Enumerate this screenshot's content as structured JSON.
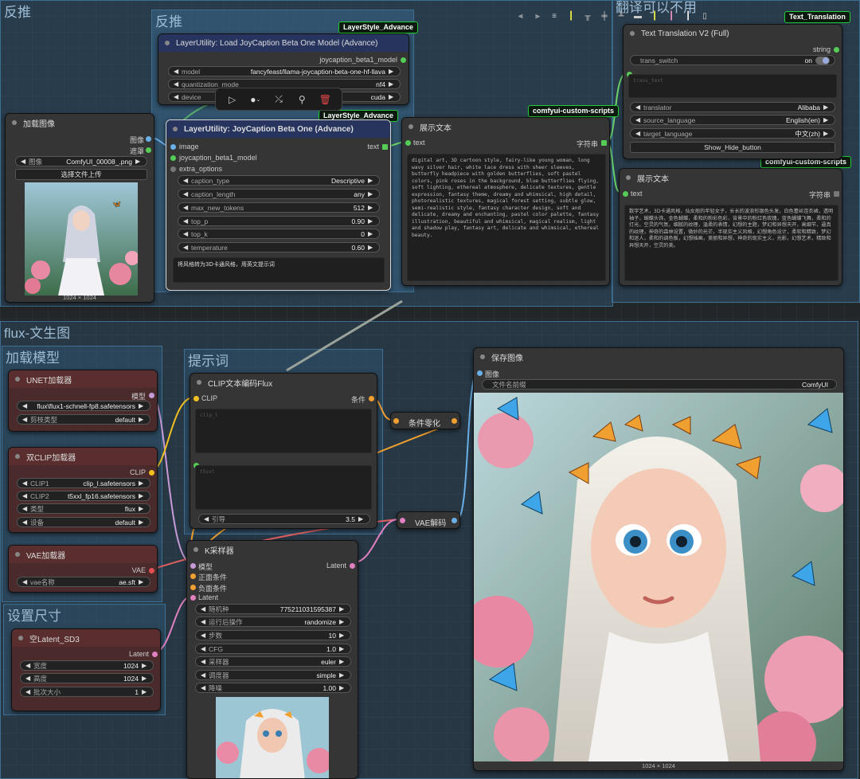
{
  "groups": {
    "top_left": "反推",
    "top_inner": "反推",
    "top_right": "翻译可以不用",
    "bottom": "flux-文生图",
    "load_model": "加载模型",
    "prompt": "提示词",
    "size": "设置尺寸"
  },
  "badges": {
    "layerstyle_1": "LayerStyle_Advance",
    "layerstyle_2": "LayerStyle_Advance",
    "custom_scripts_1": "comfyui-custom-scripts",
    "custom_scripts_2": "comfyui-custom-scripts",
    "text_translation": "Text_Translation"
  },
  "load_image": {
    "title": "加载图像",
    "out_image": "图像",
    "out_mask": "遮罩",
    "image_label": "图像",
    "image_value": "ComfyUI_00008_.png",
    "upload": "选择文件上传",
    "size": "1024 × 1024"
  },
  "load_joycaption": {
    "title": "LayerUtility: Load JoyCaption Beta One Model (Advance)",
    "out": "joycaption_beta1_model",
    "widgets": [
      {
        "label": "model",
        "value": "fancyfeast/llama-joycaption-beta-one-hf-llava"
      },
      {
        "label": "quantization_mode",
        "value": "nf4"
      },
      {
        "label": "device",
        "value": "cuda"
      }
    ]
  },
  "joycaption": {
    "title": "LayerUtility: JoyCaption Beta One (Advance)",
    "in_image": "image",
    "in_model": "joycaption_beta1_model",
    "in_extra": "extra_options",
    "out_text": "text",
    "widgets": [
      {
        "label": "caption_type",
        "value": "Descriptive"
      },
      {
        "label": "caption_length",
        "value": "any"
      },
      {
        "label": "max_new_tokens",
        "value": "512"
      },
      {
        "label": "top_p",
        "value": "0.90"
      },
      {
        "label": "top_k",
        "value": "0"
      },
      {
        "label": "temperature",
        "value": "0.60"
      }
    ],
    "prompt_text": "将风格转为3D卡通风格，用英文提示词"
  },
  "show_text_1": {
    "title": "展示文本",
    "in_text": "text",
    "out": "字符串",
    "content": "digital art, 3D cartoon style, fairy-like young woman, long wavy silver hair, white lace dress with sheer sleeves, butterfly headpiece with golden butterflies, soft pastel colors, pink roses in the background, blue butterflies flying, soft lighting, ethereal atmosphere, delicate textures, gentle expression, fantasy theme, dreamy and whimsical, high detail, photorealistic textures, magical forest setting, subtle glow, semi-realistic style, fantasy character design, soft and delicate, dreamy and enchanting, pastel color palette, fantasy illustration, beautiful and whimsical, magical realism, light and shadow play, fantasy art, delicate and whimsical, ethereal beauty."
  },
  "translation": {
    "title": "Text Translation V2 (Full)",
    "out": "string",
    "switch_label": "trans_switch",
    "switch_value": "on",
    "placeholder": "trans_text",
    "widgets": [
      {
        "label": "translator",
        "value": "Alibaba"
      },
      {
        "label": "source_language",
        "value": "English(en)"
      },
      {
        "label": "target_language",
        "value": "中文(zh)"
      }
    ],
    "button": "Show_Hide_button"
  },
  "show_text_2": {
    "title": "展示文本",
    "in_text": "text",
    "out": "字符串",
    "content": "数字艺术，3D卡通风格，仙女般的年轻女子，长长的波浪形银色头发，白色蕾丝连衣裙，透明袖子，蝴蝶头饰，金色蝴蝶，柔和的粉彩色彩，背景中的粉红色玫瑰，蓝色蝴蝶飞舞，柔和的灯光，空灵的气氛，细腻的纹理，温柔的表情，幻想的主题，梦幻和异想天开，高细节，逼真的纹理，神奇的森林设置，微妙的光芒，半现实主义风格，幻想角色设计，柔软和精致，梦幻和迷人，柔和的调色板，幻想插画，美丽和异想，神奇的现实主义，光影，幻想艺术，精致和异想天开，空灵的美。"
  },
  "toolbar": {
    "run": "▷",
    "color": "●",
    "bypass": "bypass",
    "pin": "pin",
    "delete": "delete"
  },
  "unet": {
    "title": "UNET加载器",
    "out": "模型",
    "widgets": [
      {
        "label": "",
        "value": "flux\\flux1-schnell-fp8.safetensors"
      },
      {
        "label": "剪枝类型",
        "value": "default"
      }
    ]
  },
  "dual_clip": {
    "title": "双CLIP加载器",
    "out": "CLIP",
    "widgets": [
      {
        "label": "CLIP1",
        "value": "clip_l.safetensors"
      },
      {
        "label": "CLIP2",
        "value": "t5xxl_fp16.safetensors"
      },
      {
        "label": "类型",
        "value": "flux"
      },
      {
        "label": "设备",
        "value": "default"
      }
    ]
  },
  "vae_loader": {
    "title": "VAE加载器",
    "out": "VAE",
    "widgets": [
      {
        "label": "vae名称",
        "value": "ae.sft"
      }
    ]
  },
  "empty_latent": {
    "title": "空Latent_SD3",
    "out": "Latent",
    "widgets": [
      {
        "label": "宽度",
        "value": "1024"
      },
      {
        "label": "高度",
        "value": "1024"
      },
      {
        "label": "批次大小",
        "value": "1"
      }
    ]
  },
  "clip_encode": {
    "title": "CLIP文本编码Flux",
    "in_clip": "CLIP",
    "out": "条件",
    "placeholder_1": "clip_l",
    "placeholder_2": "t5xxl",
    "guidance_label": "引导",
    "guidance_value": "3.5"
  },
  "cond_zero": {
    "title": "条件零化"
  },
  "vae_decode": {
    "title": "VAE解码"
  },
  "ksampler": {
    "title": "K采样器",
    "in_model": "模型",
    "in_pos": "正面条件",
    "in_neg": "负面条件",
    "in_latent": "Latent",
    "out": "Latent",
    "widgets": [
      {
        "label": "随机种",
        "value": "775211031595387"
      },
      {
        "label": "运行后操作",
        "value": "randomize"
      },
      {
        "label": "步数",
        "value": "10"
      },
      {
        "label": "CFG",
        "value": "1.0"
      },
      {
        "label": "采样器",
        "value": "euler"
      },
      {
        "label": "调度器",
        "value": "simple"
      },
      {
        "label": "降噪",
        "value": "1.00"
      }
    ]
  },
  "save_image": {
    "title": "保存图像",
    "in_image": "图像",
    "prefix_label": "文件名前缀",
    "prefix_value": "ComfyUI",
    "size": "1024 × 1024"
  },
  "colors": {
    "accent_green": "#33cc44",
    "group_blue": "#3d6f92",
    "node_red": "#5a2e2e"
  }
}
